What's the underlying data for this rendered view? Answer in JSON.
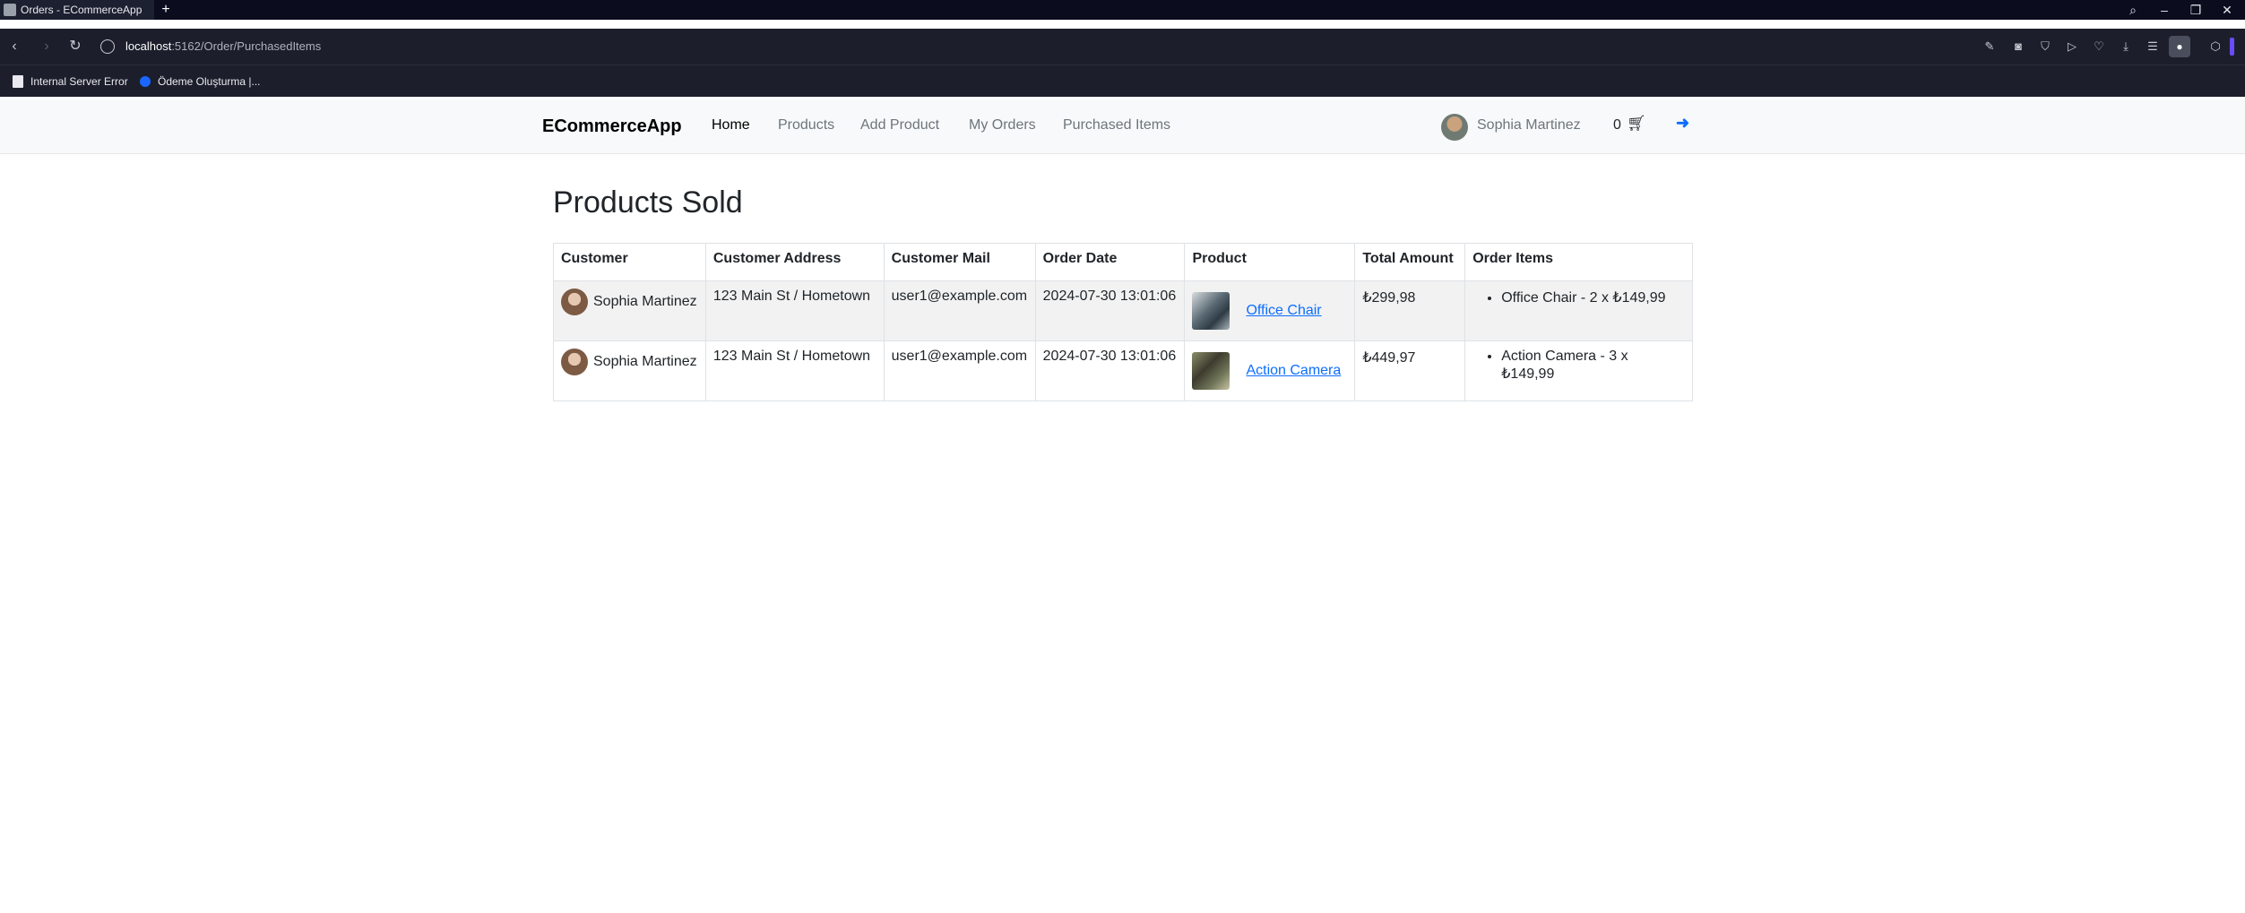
{
  "browser": {
    "tab_title": "Orders - ECommerceApp",
    "url_host": "localhost",
    "url_rest": ":5162/Order/PurchasedItems",
    "bookmarks": [
      "Internal Server Error",
      "Ödeme Oluşturma |..."
    ]
  },
  "navbar": {
    "brand": "ECommerceApp",
    "links": [
      "Home",
      "Products",
      "Add Product",
      "My Orders",
      "Purchased Items"
    ],
    "user_name": "Sophia Martinez",
    "cart_count": "0"
  },
  "page": {
    "title": "Products Sold",
    "columns": [
      "Customer",
      "Customer Address",
      "Customer Mail",
      "Order Date",
      "Product",
      "Total Amount",
      "Order Items"
    ],
    "rows": [
      {
        "customer": "Sophia Martinez",
        "address": "123 Main St / Hometown",
        "mail": "user1@example.com",
        "date": "2024-07-30 13:01:06",
        "product": "Office Chair",
        "total": "₺299,98",
        "items": [
          "Office Chair - 2 x ₺149,99"
        ]
      },
      {
        "customer": "Sophia Martinez",
        "address": "123 Main St / Hometown",
        "mail": "user1@example.com",
        "date": "2024-07-30 13:01:06",
        "product": "Action Camera",
        "total": "₺449,97",
        "items": [
          "Action Camera - 3 x ₺149,99"
        ]
      }
    ]
  },
  "colors": {
    "link": "#0d6efd",
    "navbar_bg": "#f8f9fa",
    "stripe": "#f2f2f2"
  }
}
